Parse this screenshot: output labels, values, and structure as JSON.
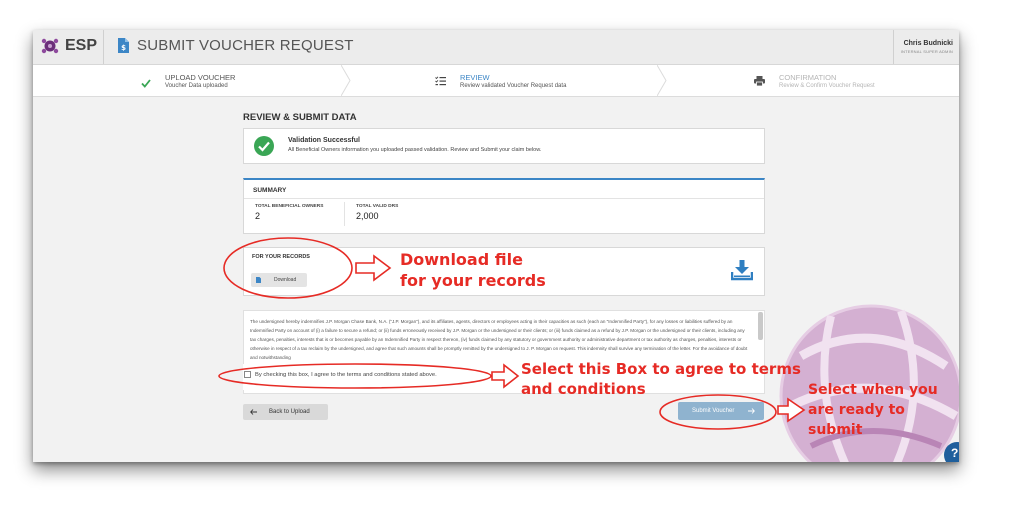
{
  "app": {
    "logo_text": "ESP",
    "page_title": "SUBMIT VOUCHER REQUEST"
  },
  "user": {
    "name": "Chris Budnicki",
    "role": "INTERNAL SUPER ADMIN"
  },
  "steps": [
    {
      "title": "UPLOAD VOUCHER",
      "subtitle": "Voucher Data uploaded",
      "state": "done"
    },
    {
      "title": "REVIEW",
      "subtitle": "Review validated Voucher Request data",
      "state": "active"
    },
    {
      "title": "CONFIRMATION",
      "subtitle": "Review & Confirm Voucher Request",
      "state": "pending"
    }
  ],
  "main": {
    "title": "REVIEW & SUBMIT DATA"
  },
  "validation": {
    "title": "Validation Successful",
    "message": "All Beneficial Owners information you uploaded passed validation. Review and Submit your claim below."
  },
  "summary": {
    "heading": "SUMMARY",
    "owners_label": "TOTAL BENEFICIAL OWNERS",
    "owners_value": "2",
    "drs_label": "TOTAL VALID DRS",
    "drs_value": "2,000"
  },
  "records": {
    "heading": "FOR YOUR RECORDS",
    "download_label": "Download"
  },
  "terms": {
    "text": "The undersigned hereby indemnifies J.P. Morgan Chase Bank, N.A. (\"J.P. Morgan\"), and its affiliates, agents, directors or employees acting in their capacities as such (each an \"Indemnified Party\"), for any losses or liabilities suffered by an Indemnified Party on account of (i) a failure to secure a refund; or (ii) funds erroneously received by J.P. Morgan or the undersigned or their clients; or (iii) funds claimed as a refund by J.P. Morgan or the undersigned or their clients, including any tax charges, penalties, interests that is or becomes payable by an Indemnified Party in respect thereon, (iv) funds claimed by any statutory or government authority or administrative department or tax authority as charges, penalties, interests or otherwise in respect of a tax reclaim by the undersigned, and agree that such amounts shall be promptly remitted by the undersigned to J. P. Morgan on request. This indemnity shall survive any termination of the letter. For the avoidance of doubt and notwithstanding",
    "agree_label": "By checking this box, I agree to the terms and conditions stated above.",
    "agreed": false
  },
  "buttons": {
    "back_label": "Back to Upload",
    "submit_label": "Submit Voucher"
  },
  "annotations": {
    "download_line1": "Download file",
    "download_line2": "for your records",
    "checkbox_line1": "Select this Box to agree to terms",
    "checkbox_line2": "and conditions",
    "submit_line1": "Select when you",
    "submit_line2": "are ready to",
    "submit_line3": "submit"
  },
  "help": {
    "label": "?"
  },
  "colors": {
    "accent": "#3c86c6",
    "success": "#3aa655",
    "annotation": "#e62b25",
    "submit_bg": "#8fb3cf",
    "logo": "#6b2f7a"
  }
}
